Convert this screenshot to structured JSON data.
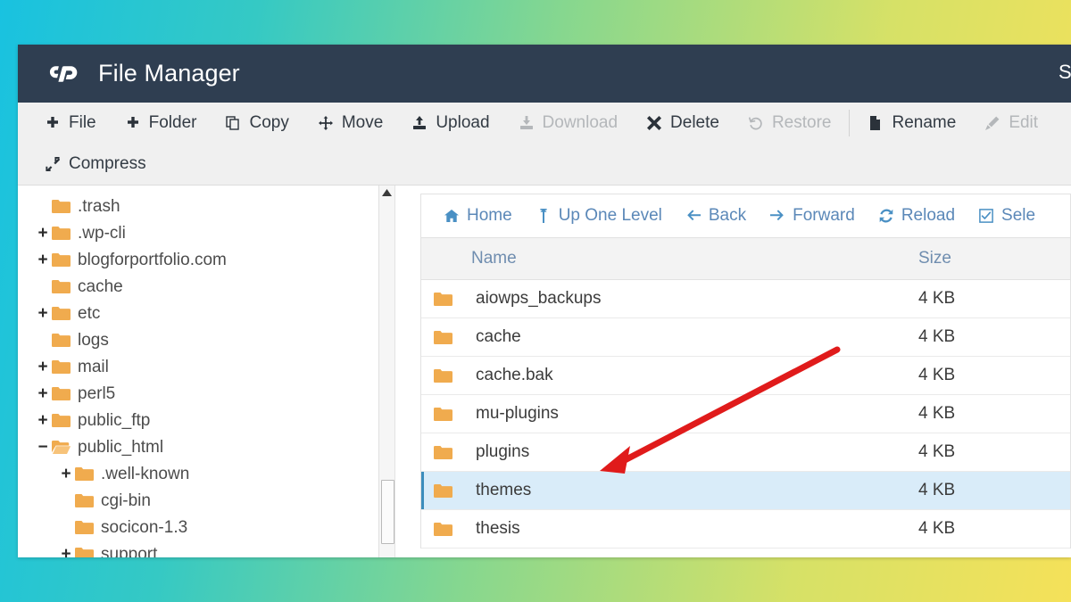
{
  "theme": {
    "gradient_left": "#19c2e0",
    "gradient_right": "#f5e159",
    "titlebar_bg": "#2f3e51",
    "toolbar_bg": "#f0f0f0",
    "folder_color": "#f0ab4e",
    "link_color": "#5b88b8",
    "selected_row_bg": "#d9ecf9",
    "selected_row_accent": "#3c8dbc",
    "annotation_color": "#e01b1b"
  },
  "titlebar": {
    "logo": "cpanel-logo",
    "title": "File Manager",
    "right_cut_label": "S"
  },
  "toolbar": {
    "rows": [
      [
        {
          "label": "File",
          "icon": "plus-icon",
          "disabled": false,
          "name": "new-file-button"
        },
        {
          "label": "Folder",
          "icon": "plus-icon",
          "disabled": false,
          "name": "new-folder-button"
        },
        {
          "label": "Copy",
          "icon": "copy-icon",
          "disabled": false,
          "name": "copy-button"
        },
        {
          "label": "Move",
          "icon": "move-icon",
          "disabled": false,
          "name": "move-button"
        },
        {
          "label": "Upload",
          "icon": "upload-icon",
          "disabled": false,
          "name": "upload-button"
        },
        {
          "label": "Download",
          "icon": "download-icon",
          "disabled": true,
          "name": "download-button"
        },
        {
          "label": "Delete",
          "icon": "times-icon",
          "disabled": false,
          "name": "delete-button"
        },
        {
          "label": "Restore",
          "icon": "restore-icon",
          "disabled": true,
          "name": "restore-button"
        },
        {
          "separator": true
        },
        {
          "label": "Rename",
          "icon": "file-icon",
          "disabled": false,
          "name": "rename-button"
        },
        {
          "label": "Edit",
          "icon": "pencil-icon",
          "disabled": true,
          "name": "edit-button"
        }
      ],
      [
        {
          "label": "Compress",
          "icon": "compress-icon",
          "disabled": false,
          "name": "compress-button"
        }
      ]
    ]
  },
  "sidebar": {
    "tree": [
      {
        "label": ".trash",
        "toggle": "",
        "indent": 0,
        "icon": "folder-icon"
      },
      {
        "label": ".wp-cli",
        "toggle": "+",
        "indent": 0,
        "icon": "folder-icon"
      },
      {
        "label": "blogforportfolio.com",
        "toggle": "+",
        "indent": 0,
        "icon": "folder-icon"
      },
      {
        "label": "cache",
        "toggle": "",
        "indent": 0,
        "icon": "folder-icon"
      },
      {
        "label": "etc",
        "toggle": "+",
        "indent": 0,
        "icon": "folder-icon"
      },
      {
        "label": "logs",
        "toggle": "",
        "indent": 0,
        "icon": "folder-icon"
      },
      {
        "label": "mail",
        "toggle": "+",
        "indent": 0,
        "icon": "folder-icon"
      },
      {
        "label": "perl5",
        "toggle": "+",
        "indent": 0,
        "icon": "folder-icon"
      },
      {
        "label": "public_ftp",
        "toggle": "+",
        "indent": 0,
        "icon": "folder-icon"
      },
      {
        "label": "public_html",
        "toggle": "−",
        "indent": 0,
        "icon": "folder-open-icon"
      },
      {
        "label": ".well-known",
        "toggle": "+",
        "indent": 1,
        "icon": "folder-icon"
      },
      {
        "label": "cgi-bin",
        "toggle": "",
        "indent": 1,
        "icon": "folder-icon"
      },
      {
        "label": "socicon-1.3",
        "toggle": "",
        "indent": 1,
        "icon": "folder-icon"
      },
      {
        "label": "support",
        "toggle": "+",
        "indent": 1,
        "icon": "folder-icon"
      }
    ],
    "scrollbar": {
      "up_arrow": "scroll-up-arrow"
    }
  },
  "filepane": {
    "nav": [
      {
        "label": "Home",
        "icon": "home-icon",
        "name": "nav-home"
      },
      {
        "label": "Up One Level",
        "icon": "up-icon",
        "name": "nav-up-one-level"
      },
      {
        "label": "Back",
        "icon": "arrow-left-icon",
        "name": "nav-back"
      },
      {
        "label": "Forward",
        "icon": "arrow-right-icon",
        "name": "nav-forward"
      },
      {
        "label": "Reload",
        "icon": "reload-icon",
        "name": "nav-reload"
      },
      {
        "label": "Sele",
        "icon": "checkbox-icon",
        "name": "nav-select-all"
      }
    ],
    "columns": {
      "name": "Name",
      "size": "Size"
    },
    "rows": [
      {
        "name": "aiowps_backups",
        "size": "4 KB",
        "selected": false
      },
      {
        "name": "cache",
        "size": "4 KB",
        "selected": false
      },
      {
        "name": "cache.bak",
        "size": "4 KB",
        "selected": false
      },
      {
        "name": "mu-plugins",
        "size": "4 KB",
        "selected": false
      },
      {
        "name": "plugins",
        "size": "4 KB",
        "selected": false
      },
      {
        "name": "themes",
        "size": "4 KB",
        "selected": true
      },
      {
        "name": "thesis",
        "size": "4 KB",
        "selected": false
      }
    ]
  },
  "annotation": {
    "type": "arrow",
    "points_to": "themes",
    "color": "#e01b1b"
  }
}
